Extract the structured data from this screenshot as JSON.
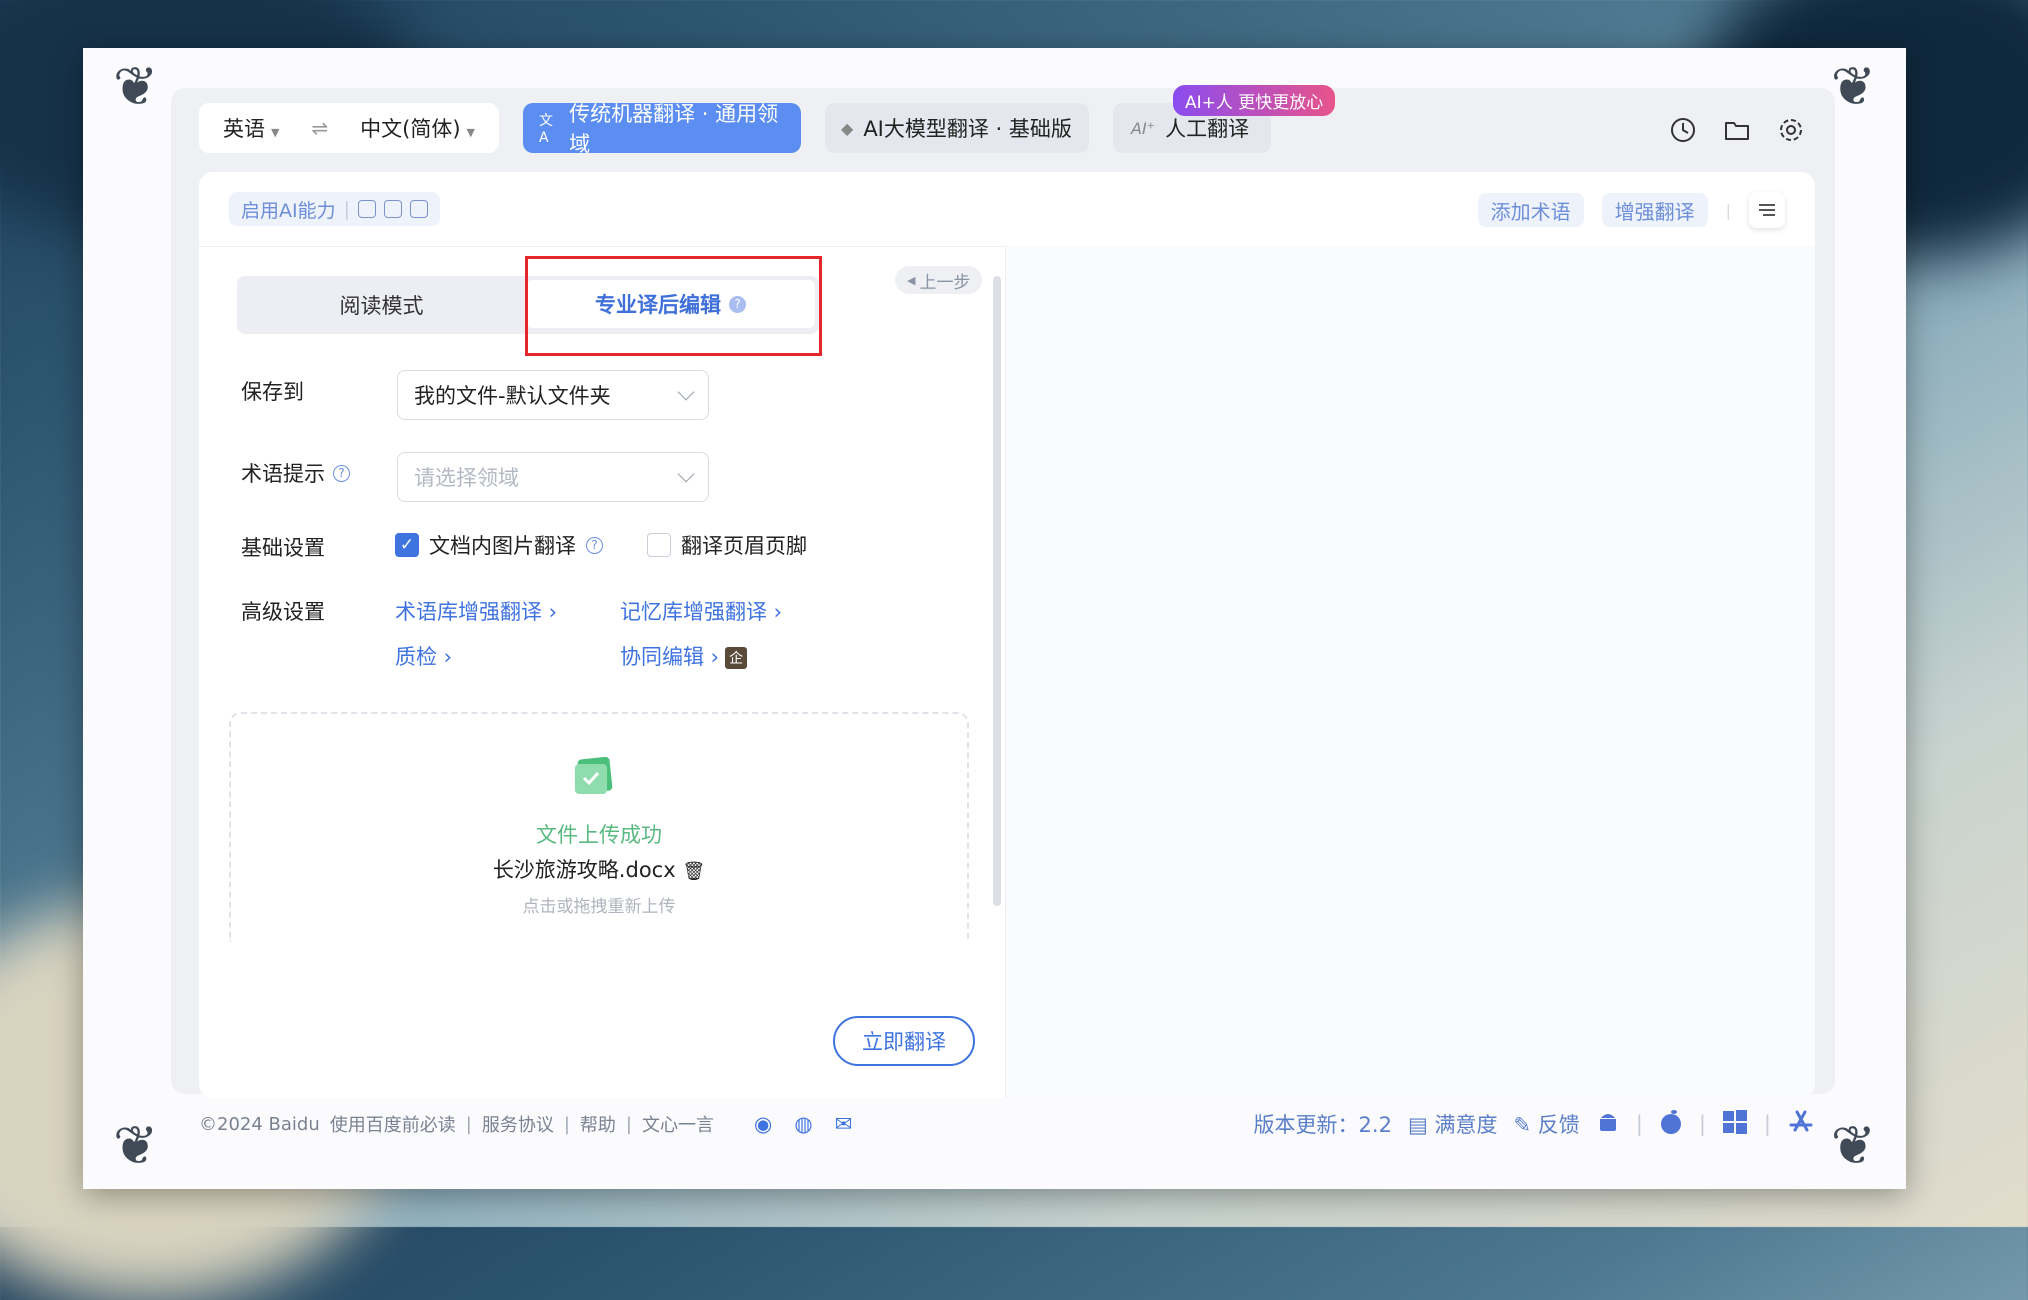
{
  "lang": {
    "source": "英语",
    "target": "中文(简体)"
  },
  "modes": {
    "machine": "传统机器翻译 · 通用领域",
    "ai_model": "AI大模型翻译 · 基础版",
    "human": "人工翻译",
    "human_badge": "AI+人 更快更放心"
  },
  "toolbar": {
    "ai_capability": "启用AI能力",
    "add_term": "添加术语",
    "enhance": "增强翻译"
  },
  "tabs": {
    "reading": "阅读模式",
    "pro_edit": "专业译后编辑"
  },
  "prev_step": "上一步",
  "form": {
    "save_to_label": "保存到",
    "save_to_value": "我的文件-默认文件夹",
    "term_label": "术语提示",
    "term_placeholder": "请选择领域",
    "basic_label": "基础设置",
    "opt_image": "文档内图片翻译",
    "opt_header": "翻译页眉页脚",
    "advanced_label": "高级设置",
    "adv_term": "术语库增强翻译",
    "adv_memory": "记忆库增强翻译",
    "adv_qc": "质检",
    "adv_collab": "协同编辑",
    "enterprise_tag": "企"
  },
  "upload": {
    "status": "文件上传成功",
    "filename": "长沙旅游攻略.docx",
    "hint": "点击或拖拽重新上传"
  },
  "translate_button": "立即翻译",
  "footer": {
    "copyright": "©2024 Baidu",
    "links": [
      "使用百度前必读",
      "服务协议",
      "帮助",
      "文心一言"
    ],
    "version": "版本更新：2.2",
    "satisfaction": "满意度",
    "feedback": "反馈"
  },
  "colors": {
    "accent": "#3f73e0",
    "mode_active": "#5b8ef0",
    "success": "#59b980",
    "highlight": "#e5262a"
  },
  "icons": [
    "history-icon",
    "folder-icon",
    "settings-icon",
    "weibo-icon",
    "wechat-icon",
    "mail-icon",
    "android-icon",
    "apple-icon",
    "windows-icon",
    "appstore-icon"
  ]
}
